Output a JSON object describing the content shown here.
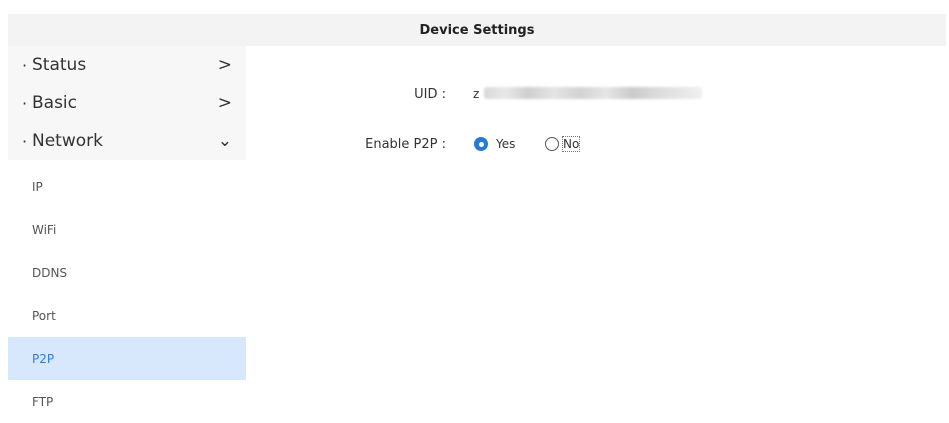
{
  "header": {
    "title": "Device Settings"
  },
  "sidebar": {
    "menu": [
      {
        "label": "Status",
        "bullet": "·",
        "chevron": ">"
      },
      {
        "label": "Basic",
        "bullet": "·",
        "chevron": ">"
      },
      {
        "label": "Network",
        "bullet": "·",
        "chevron": "⌄"
      }
    ],
    "sub_items": [
      {
        "label": "IP"
      },
      {
        "label": "WiFi"
      },
      {
        "label": "DDNS"
      },
      {
        "label": "Port"
      },
      {
        "label": "P2P",
        "active": true
      },
      {
        "label": "FTP"
      }
    ]
  },
  "form": {
    "uid_label": "UID :",
    "uid_value_visible": "z",
    "p2p_label": "Enable P2P :",
    "p2p_yes": "Yes",
    "p2p_no": "No",
    "p2p_selected": "Yes"
  },
  "colors": {
    "accent": "#2a7ad5",
    "active_bg": "#d7e8fc",
    "header_bg": "#f3f3f3"
  }
}
